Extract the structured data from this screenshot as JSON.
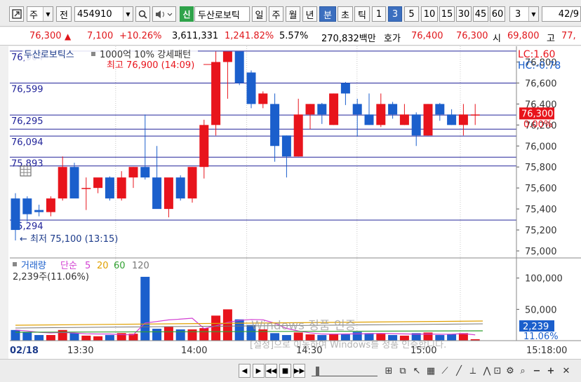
{
  "toolbar": {
    "market": "주",
    "jeon": "전",
    "code": "454910",
    "sin_badge": "신",
    "stock_name": "두산로보틱",
    "periods": [
      "일",
      "주",
      "월",
      "년"
    ],
    "active_period": "분",
    "tick_labels": [
      "초",
      "틱"
    ],
    "intervals": [
      "1",
      "3",
      "5",
      "10",
      "15",
      "30",
      "45",
      "60"
    ],
    "active_interval": "3",
    "interval_select": "3",
    "count_value": "42",
    "count_suffix": "/9"
  },
  "quote": {
    "price": "76,300",
    "change_arrow": "▲",
    "change": "7,100",
    "change_pct": "+10.26%",
    "volume": "3,611,331",
    "volume_ratio": "1,241.82%",
    "turnover_pct": "5.57%",
    "amount": "270,832백만",
    "hoga_label": "호가",
    "ask": "76,400",
    "bid": "76,300",
    "open_label": "시",
    "open": "69,800",
    "high_label": "고",
    "high": "77,"
  },
  "chart": {
    "legend_title": "두산로보틱스",
    "legend_indicator": "1000억 10% 강세패턴",
    "high_annot": "최고 76,900 (14:09)",
    "low_annot": "최저 75,100 (13:15)",
    "level_labels": [
      {
        "label": "76,904",
        "value": 76904
      },
      {
        "label": "76,599",
        "value": 76599
      },
      {
        "label": "76,295",
        "value": 76295
      },
      {
        "label": "76,094",
        "value": 76094
      },
      {
        "label": "75,893",
        "value": 75893
      },
      {
        "label": "75,294",
        "value": 75294
      }
    ],
    "extra_levels": [
      76160,
      75810
    ],
    "lc_label": "LC:1.60",
    "hc_label": "HC:-0.78",
    "current_price_box": "76,300",
    "current_pct_box": "0.00%",
    "y_ticks": [
      "76,800",
      "76,600",
      "76,400",
      "76,200",
      "76,000",
      "75,800",
      "75,600",
      "75,400",
      "75,200",
      "75,000"
    ],
    "y_tick_values": [
      76800,
      76600,
      76400,
      76200,
      76000,
      75800,
      75600,
      75400,
      75200,
      75000
    ],
    "y_range": [
      74960,
      76950
    ],
    "up_color": "#e8141c",
    "down_color": "#1b5fcc"
  },
  "chart_data": {
    "type": "candlestick",
    "interval_minutes": 3,
    "candles": [
      {
        "o": 75500,
        "h": 75550,
        "l": 75100,
        "c": 75200
      },
      {
        "o": 75500,
        "h": 75520,
        "l": 75280,
        "c": 75350
      },
      {
        "o": 75390,
        "h": 75440,
        "l": 75330,
        "c": 75370
      },
      {
        "o": 75370,
        "h": 75520,
        "l": 75330,
        "c": 75500
      },
      {
        "o": 75500,
        "h": 75900,
        "l": 75480,
        "c": 75800
      },
      {
        "o": 75800,
        "h": 75840,
        "l": 75540,
        "c": 75500
      },
      {
        "o": 75600,
        "h": 75700,
        "l": 75390,
        "c": 75600
      },
      {
        "o": 75600,
        "h": 75680,
        "l": 75550,
        "c": 75700
      },
      {
        "o": 75700,
        "h": 75710,
        "l": 75480,
        "c": 75500
      },
      {
        "o": 75500,
        "h": 75760,
        "l": 75480,
        "c": 75700
      },
      {
        "o": 75700,
        "h": 75800,
        "l": 75600,
        "c": 75800
      },
      {
        "o": 75800,
        "h": 76300,
        "l": 75680,
        "c": 75700
      },
      {
        "o": 75700,
        "h": 76000,
        "l": 75450,
        "c": 75400
      },
      {
        "o": 75400,
        "h": 75690,
        "l": 75320,
        "c": 75700
      },
      {
        "o": 75700,
        "h": 75720,
        "l": 75480,
        "c": 75500
      },
      {
        "o": 75500,
        "h": 75800,
        "l": 75460,
        "c": 75800
      },
      {
        "o": 75800,
        "h": 76250,
        "l": 75690,
        "c": 76200
      },
      {
        "o": 76200,
        "h": 76900,
        "l": 76100,
        "c": 76800
      },
      {
        "o": 76800,
        "h": 76900,
        "l": 76450,
        "c": 76900
      },
      {
        "o": 76900,
        "h": 76900,
        "l": 76580,
        "c": 76600
      },
      {
        "o": 76700,
        "h": 76720,
        "l": 76360,
        "c": 76400
      },
      {
        "o": 76400,
        "h": 76520,
        "l": 76360,
        "c": 76500
      },
      {
        "o": 76400,
        "h": 76500,
        "l": 75850,
        "c": 76000
      },
      {
        "o": 76100,
        "h": 76100,
        "l": 75700,
        "c": 75900
      },
      {
        "o": 75900,
        "h": 76450,
        "l": 75900,
        "c": 76300
      },
      {
        "o": 76300,
        "h": 76400,
        "l": 76160,
        "c": 76400
      },
      {
        "o": 76400,
        "h": 76410,
        "l": 76210,
        "c": 76300
      },
      {
        "o": 76200,
        "h": 76500,
        "l": 76200,
        "c": 76500
      },
      {
        "o": 76600,
        "h": 76610,
        "l": 76390,
        "c": 76500
      },
      {
        "o": 76400,
        "h": 76450,
        "l": 76090,
        "c": 76300
      },
      {
        "o": 76300,
        "h": 76500,
        "l": 76200,
        "c": 76200
      },
      {
        "o": 76200,
        "h": 76500,
        "l": 76180,
        "c": 76400
      },
      {
        "o": 76400,
        "h": 76420,
        "l": 76260,
        "c": 76300
      },
      {
        "o": 76200,
        "h": 76400,
        "l": 76200,
        "c": 76300
      },
      {
        "o": 76300,
        "h": 76320,
        "l": 76000,
        "c": 76100
      },
      {
        "o": 76100,
        "h": 76400,
        "l": 76100,
        "c": 76400
      },
      {
        "o": 76400,
        "h": 76410,
        "l": 76240,
        "c": 76300
      },
      {
        "o": 76300,
        "h": 76350,
        "l": 76200,
        "c": 76200
      },
      {
        "o": 76200,
        "h": 76400,
        "l": 76100,
        "c": 76300
      },
      {
        "o": 76300,
        "h": 76400,
        "l": 76200,
        "c": 76300
      }
    ],
    "x_ticks": [
      "02/18",
      "13:30",
      "14:00",
      "14:30",
      "15:00",
      "15:18:00"
    ],
    "volume_title": "거래량",
    "ma_label": "단순",
    "ma_periods": [
      "5",
      "20",
      "60",
      "120"
    ],
    "volume_info": "2,239주(11.06%)",
    "volume_y_ticks": [
      "100,000",
      "50,000"
    ],
    "volume_y_values": [
      100000,
      50000
    ],
    "volume_current_box": "2,239",
    "volume_pct_box": "11.06%",
    "volumes": [
      17000,
      14000,
      9000,
      9000,
      17000,
      12000,
      8000,
      7000,
      9000,
      12000,
      11000,
      102000,
      19000,
      22000,
      18000,
      18000,
      20000,
      40000,
      50000,
      34000,
      25000,
      18000,
      12000,
      9000,
      13000,
      10000,
      9000,
      11000,
      10000,
      14000,
      12000,
      11000,
      9000,
      8000,
      12000,
      13000,
      9000,
      10000,
      12000,
      2239
    ]
  },
  "watermark": {
    "line1": "Windows 정품 인증",
    "line2": "[설정]으로 이동하여 Windows를 정품 인증합니다."
  }
}
